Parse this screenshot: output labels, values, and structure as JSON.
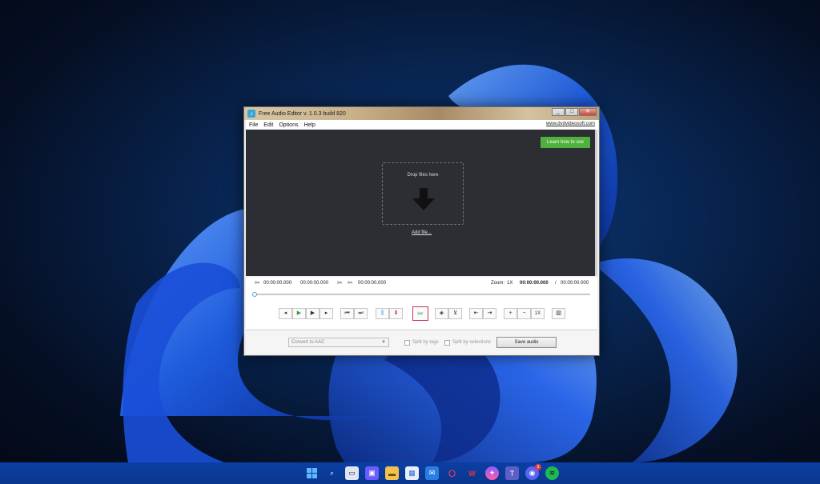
{
  "window": {
    "title": "Free Audio Editor v. 1.0.3 build 820",
    "controls": [
      "_",
      "□",
      "✕"
    ]
  },
  "menu": {
    "items": [
      "File",
      "Edit",
      "Options",
      "Help"
    ],
    "site_link": "www.dvdvideosoft.com"
  },
  "drop_area": {
    "learn_button": "Learn how to use",
    "drop_text": "Drop files here",
    "add_file": "Add file..."
  },
  "timebar": {
    "start_time": "00:00:00.000",
    "end_time": "00:00:00.000",
    "cut_time": "00:00:00.000",
    "zoom_label": "Zoom:",
    "zoom_value": "1X",
    "current_time": "00:00:00.000",
    "separator": "/",
    "total_time": "00:00:00.000"
  },
  "player": {
    "zoom_reset": "1X"
  },
  "bottom": {
    "format_select": "Convert to AAC",
    "split_by_tags": "Split by tags",
    "split_by_selections": "Split by selections",
    "save_button": "Save audio"
  },
  "taskbar": {
    "discord_badge": "3"
  },
  "colors": {
    "accent_green": "#4fb03b",
    "drop_bg": "#2c2e33",
    "taskbar": "#0b3fa3"
  }
}
